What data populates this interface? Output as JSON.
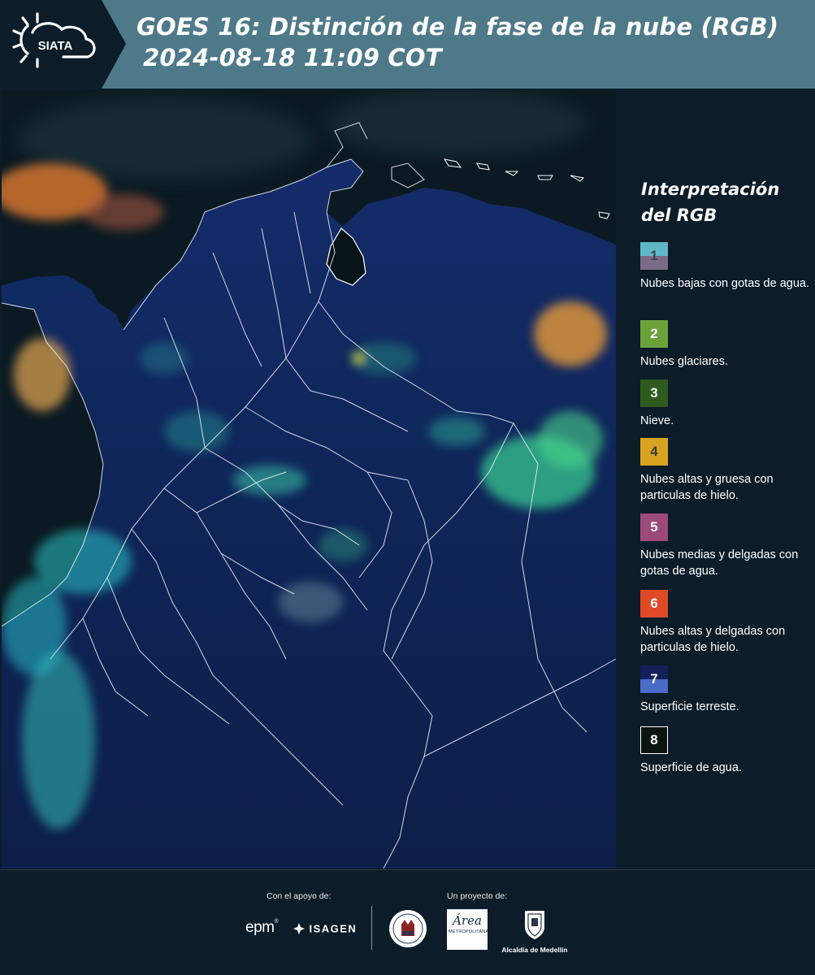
{
  "header": {
    "logo_text": "SIATA",
    "title_line1": "GOES 16: Distinción de la fase de la nube (RGB)",
    "title_line2": "2024-08-18 11:09 COT"
  },
  "legend": {
    "title": "Interpretación del RGB",
    "items": [
      {
        "number": "1",
        "label": "Nubes bajas con gotas de agua.",
        "colors": [
          "#5fb8c8",
          "#7c6b88"
        ]
      },
      {
        "number": "2",
        "label": "Nubes glaciares.",
        "colors": [
          "#6aa23a"
        ]
      },
      {
        "number": "3",
        "label": "Nieve.",
        "colors": [
          "#2e5a1e"
        ]
      },
      {
        "number": "4",
        "label": "Nubes altas y gruesa con particulas de hielo.",
        "colors": [
          "#d9a320"
        ]
      },
      {
        "number": "5",
        "label": "Nubes medias y delgadas con gotas de agua.",
        "colors": [
          "#9c4a7a"
        ]
      },
      {
        "number": "6",
        "label": "Nubes altas y delgadas con particulas de hielo.",
        "colors": [
          "#e04a26"
        ]
      },
      {
        "number": "7",
        "label": "Superficie terreste.",
        "colors": [
          "#13205a",
          "#4a6cc8"
        ]
      },
      {
        "number": "8",
        "label": "Superficie de agua.",
        "colors": [
          "#0a1510"
        ]
      }
    ]
  },
  "footer": {
    "support_label": "Con el apoyo de:",
    "project_label": "Un proyecto de:",
    "sponsors": [
      "epm",
      "ISAGEN"
    ],
    "partners": [
      "Área Metropolitana Valle de Aburrá",
      "Alcaldía de Medellín"
    ],
    "epm_text": "epm",
    "isagen_text": "ISAGEN",
    "area_text": "Área",
    "area_sub": "METROPOLITANA",
    "alcaldia_text": "Alcaldía de Medellín"
  },
  "colors": {
    "header_bg": "#4e7988",
    "logo_bg": "#0c1c28",
    "page_bg": "#0c1c28"
  }
}
